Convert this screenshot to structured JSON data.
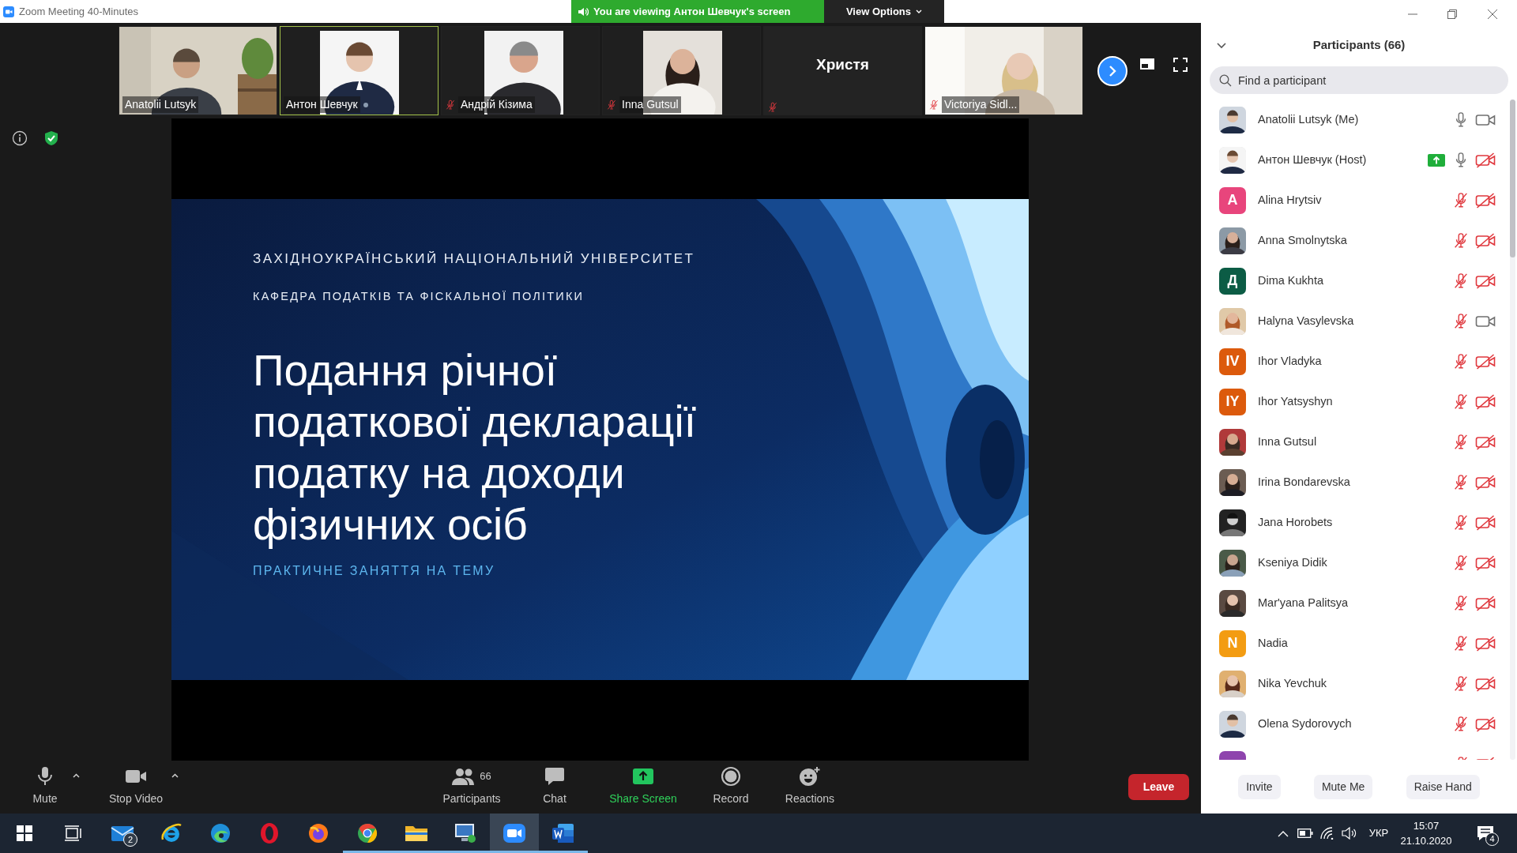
{
  "window": {
    "title": "Zoom Meeting 40-Minutes"
  },
  "banner": {
    "text": "You are viewing Антон Шевчук's screen",
    "view_options": "View Options"
  },
  "thumbnails": [
    {
      "name": "Anatolii Lutsyk",
      "kind": "video",
      "muted": false,
      "selected": false,
      "indicator": false
    },
    {
      "name": "Антон Шевчук",
      "kind": "video",
      "muted": false,
      "selected": true,
      "indicator": true
    },
    {
      "name": "Андрій Кізима",
      "kind": "video",
      "muted": true,
      "selected": false,
      "indicator": false
    },
    {
      "name": "Inna Gutsul",
      "kind": "video",
      "muted": true,
      "selected": false,
      "indicator": false
    },
    {
      "name": "Христя",
      "kind": "name-only",
      "muted": true,
      "selected": false,
      "indicator": false
    },
    {
      "name": "Victoriya Sidl...",
      "kind": "video",
      "muted": true,
      "selected": false,
      "indicator": false
    }
  ],
  "slide": {
    "university": "ЗАХІДНОУКРАЇНСЬКИЙ НАЦІОНАЛЬНИЙ УНІВЕРСИТЕТ",
    "department": "КАФЕДРА ПОДАТКІВ ТА ФІСКАЛЬНОЇ ПОЛІТИКИ",
    "title": "Подання річної\nподаткової декларації\nподатку на доходи\nфізичних осіб",
    "subtitle": "ПРАКТИЧНЕ ЗАНЯТТЯ НА ТЕМУ"
  },
  "toolbar": {
    "items": [
      {
        "kind": "mic",
        "label": "Mute",
        "caret": true
      },
      {
        "kind": "video",
        "label": "Stop Video",
        "caret": true
      },
      {
        "kind": "participants",
        "label": "Participants",
        "count": "66",
        "caret": false
      },
      {
        "kind": "chat",
        "label": "Chat",
        "caret": false
      },
      {
        "kind": "share",
        "label": "Share Screen",
        "caret": false
      },
      {
        "kind": "record",
        "label": "Record",
        "caret": false
      },
      {
        "kind": "reactions",
        "label": "Reactions",
        "caret": false
      }
    ],
    "leave": "Leave"
  },
  "panel": {
    "title": "Participants (66)",
    "search": {
      "placeholder": "Find a participant"
    },
    "participants": [
      {
        "name": "Anatolii Lutsyk (Me)",
        "muted": false,
        "camera_on": true,
        "sharing": false
      },
      {
        "name": "Антон Шевчук (Host)",
        "muted": false,
        "camera_on": false,
        "sharing": true
      },
      {
        "name": "Alina Hrytsiv",
        "kind": "initials",
        "initials": "A",
        "color": "#e8457c",
        "muted": true,
        "camera_on": false,
        "sharing": false
      },
      {
        "name": "Anna Smolnytska",
        "muted": true,
        "camera_on": false,
        "sharing": false
      },
      {
        "name": "Dima Kukhta",
        "kind": "initials",
        "initials": "Д",
        "color": "#0c5c45",
        "muted": true,
        "camera_on": false,
        "sharing": false
      },
      {
        "name": "Halyna Vasylevska",
        "muted": true,
        "camera_on": true,
        "sharing": false
      },
      {
        "name": "Ihor Vladyka",
        "kind": "initials",
        "initials": "IV",
        "color": "#dc5a0c",
        "muted": true,
        "camera_on": false,
        "sharing": false
      },
      {
        "name": "Ihor Yatsyshyn",
        "kind": "initials",
        "initials": "IY",
        "color": "#dc5a0c",
        "muted": true,
        "camera_on": false,
        "sharing": false
      },
      {
        "name": "Inna Gutsul",
        "muted": true,
        "camera_on": false,
        "sharing": false
      },
      {
        "name": "Irina Bondarevska",
        "muted": true,
        "camera_on": false,
        "sharing": false
      },
      {
        "name": "Jana Horobets",
        "muted": true,
        "camera_on": false,
        "sharing": false
      },
      {
        "name": "Kseniya Didik",
        "muted": true,
        "camera_on": false,
        "sharing": false
      },
      {
        "name": "Mar'yana Palitsya",
        "muted": true,
        "camera_on": false,
        "sharing": false
      },
      {
        "name": "Nadia",
        "kind": "initials",
        "initials": "N",
        "color": "#f39c12",
        "muted": true,
        "camera_on": false,
        "sharing": false
      },
      {
        "name": "Nika Yevchuk",
        "muted": true,
        "camera_on": false,
        "sharing": false
      },
      {
        "name": "Olena Sydorovych",
        "muted": true,
        "camera_on": false,
        "sharing": false
      },
      {
        "kind": "initials",
        "color": "#8e44ad",
        "muted": true,
        "camera_on": false,
        "sharing": false
      }
    ],
    "buttons": [
      "Invite",
      "Mute Me",
      "Raise Hand"
    ]
  },
  "taskbar": {
    "apps": [
      {
        "kind": "start",
        "running": false,
        "active": false
      },
      {
        "kind": "task-view",
        "running": false,
        "active": false
      },
      {
        "kind": "mail",
        "badge": "2",
        "running": false,
        "active": false
      },
      {
        "kind": "ie",
        "running": false,
        "active": false
      },
      {
        "kind": "edge",
        "running": false,
        "active": false
      },
      {
        "kind": "opera",
        "running": false,
        "active": false
      },
      {
        "kind": "firefox",
        "running": false,
        "active": false
      },
      {
        "kind": "chrome",
        "running": true,
        "active": false
      },
      {
        "kind": "explorer",
        "running": true,
        "active": false
      },
      {
        "kind": "remote-desktop",
        "running": true,
        "active": false
      },
      {
        "kind": "zoom",
        "running": true,
        "active": true
      },
      {
        "kind": "word",
        "running": true,
        "active": false
      }
    ],
    "tray": {
      "language": "УКР",
      "time": "15:07",
      "date": "21.10.2020",
      "notifications": "4"
    }
  }
}
